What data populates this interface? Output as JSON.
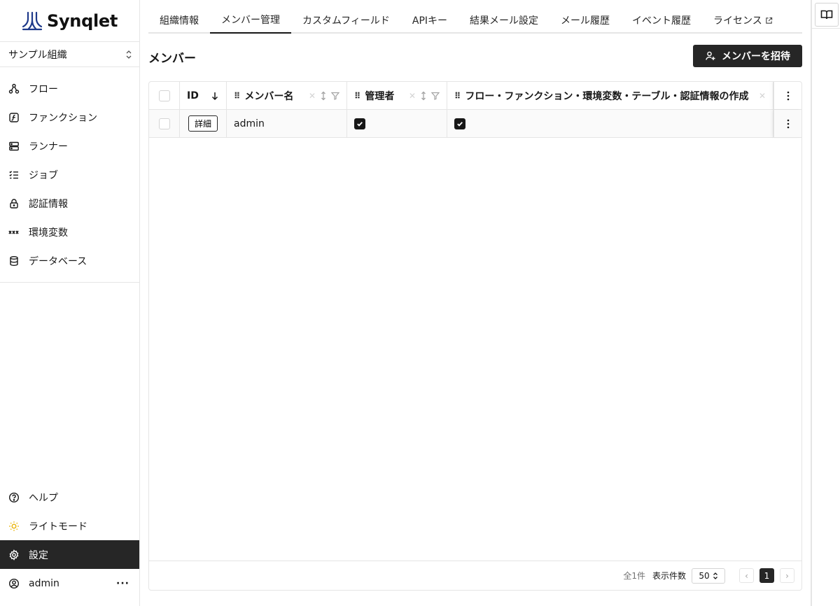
{
  "app": {
    "logo_text": "Synqlet",
    "org_name": "サンプル組織"
  },
  "sidebar": {
    "items": [
      {
        "label": "フロー",
        "icon": "flow-icon"
      },
      {
        "label": "ファンクション",
        "icon": "function-icon"
      },
      {
        "label": "ランナー",
        "icon": "server-icon"
      },
      {
        "label": "ジョブ",
        "icon": "checklist-icon"
      },
      {
        "label": "認証情報",
        "icon": "lock-icon"
      },
      {
        "label": "環境変数",
        "icon": "variable-icon"
      },
      {
        "label": "データベース",
        "icon": "database-icon"
      }
    ],
    "bottom": {
      "help": "ヘルプ",
      "theme": "ライトモード",
      "settings": "設定",
      "user": "admin",
      "user_more": "···"
    }
  },
  "tabs": [
    {
      "label": "組織情報"
    },
    {
      "label": "メンバー管理"
    },
    {
      "label": "カスタムフィールド"
    },
    {
      "label": "APIキー"
    },
    {
      "label": "結果メール設定"
    },
    {
      "label": "メール履歴"
    },
    {
      "label": "イベント履歴"
    },
    {
      "label": "ライセンス"
    }
  ],
  "members": {
    "title": "メンバー",
    "invite_label": "メンバーを招待",
    "columns": {
      "id": "ID",
      "name": "メンバー名",
      "admin": "管理者",
      "perm": "フロー・ファンクション・環境変数・テーブル・認証情報の作成"
    },
    "rows": [
      {
        "detail": "詳細",
        "name": "admin",
        "admin": true,
        "perm": true
      }
    ],
    "pager": {
      "count": "全1件",
      "per_page_label": "表示件数",
      "per_page": "50",
      "prev": "‹",
      "page": "1",
      "next": "›"
    }
  },
  "colors": {
    "accent": "#262626",
    "border": "#e5e5e5",
    "sun": "#eab308"
  }
}
